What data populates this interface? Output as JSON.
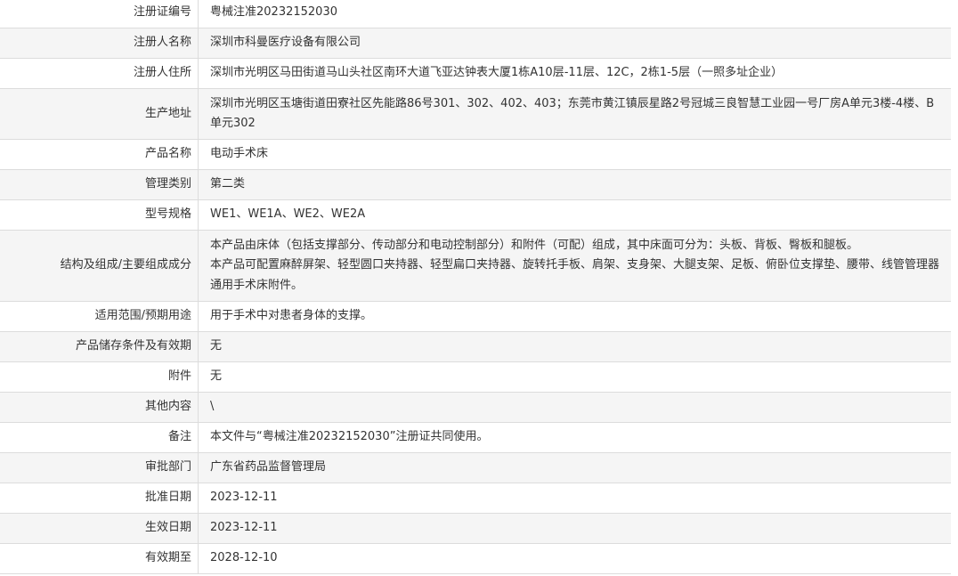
{
  "rows": [
    {
      "label": "注册证编号",
      "value": "粤械注准20232152030"
    },
    {
      "label": "注册人名称",
      "value": "深圳市科曼医疗设备有限公司"
    },
    {
      "label": "注册人住所",
      "value": "深圳市光明区马田街道马山头社区南环大道飞亚达钟表大厦1栋A10层-11层、12C，2栋1-5层（一照多址企业）"
    },
    {
      "label": "生产地址",
      "value": "深圳市光明区玉塘街道田寮社区先能路86号301、302、402、403；东莞市黄江镇辰星路2号冠城三良智慧工业园一号厂房A单元3楼-4楼、B单元302"
    },
    {
      "label": "产品名称",
      "value": "电动手术床"
    },
    {
      "label": "管理类别",
      "value": "第二类"
    },
    {
      "label": "型号规格",
      "value": "WE1、WE1A、WE2、WE2A"
    },
    {
      "label": "结构及组成/主要组成成分",
      "lines": [
        "本产品由床体（包括支撑部分、传动部分和电动控制部分）和附件（可配）组成，其中床面可分为：头板、背板、臀板和腿板。",
        "本产品可配置麻醉屏架、轻型圆口夹持器、轻型扁口夹持器、旋转托手板、肩架、支身架、大腿支架、足板、俯卧位支撑垫、腰带、线管管理器通用手术床附件。"
      ]
    },
    {
      "label": "适用范围/预期用途",
      "value": "用于手术中对患者身体的支撑。"
    },
    {
      "label": "产品储存条件及有效期",
      "value": "无"
    },
    {
      "label": "附件",
      "value": "无"
    },
    {
      "label": "其他内容",
      "value": "\\"
    },
    {
      "label": "备注",
      "value": "本文件与“粤械注准20232152030”注册证共同使用。"
    },
    {
      "label": "审批部门",
      "value": "广东省药品监督管理局"
    },
    {
      "label": "批准日期",
      "value": "2023-12-11"
    },
    {
      "label": "生效日期",
      "value": "2023-12-11"
    },
    {
      "label": "有效期至",
      "value": "2028-12-10"
    }
  ]
}
